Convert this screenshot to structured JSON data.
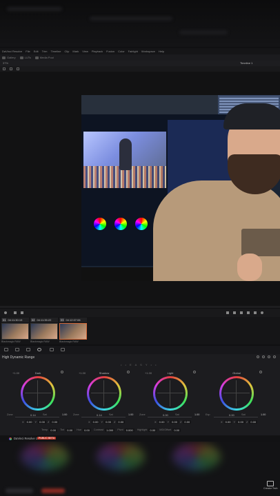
{
  "menu": {
    "items": [
      "DaVinci Resolve",
      "File",
      "Edit",
      "Trim",
      "Timeline",
      "Clip",
      "Mark",
      "View",
      "Playback",
      "Fusion",
      "Color",
      "Fairlight",
      "Workspace",
      "Help"
    ]
  },
  "toolbar": {
    "items": [
      "Gallery",
      "LUTs",
      "Media Pool"
    ]
  },
  "viewer": {
    "zoom": "37%",
    "timeline_name": "Timeline 1"
  },
  "clips": [
    {
      "num": "01",
      "timecode": "04:11:30:19",
      "label": "Blackmagic RAW",
      "selected": false
    },
    {
      "num": "02",
      "timecode": "04:11:35:22",
      "label": "Blackmagic RAW",
      "selected": false
    },
    {
      "num": "03",
      "timecode": "04:12:07:06",
      "label": "Blackmagic RAW",
      "selected": true
    }
  ],
  "hdr_panel": {
    "title": "High Dynamic Range",
    "mode_label": "• • E A S Y • •",
    "zones": [
      {
        "name": "Dark",
        "exp": "+1.00",
        "tag_left": "Zone",
        "slider_val": "0.14",
        "tag_right": "Sat",
        "sat": "1.00",
        "x": "0.00",
        "y": "0.00",
        "z": "0.00"
      },
      {
        "name": "Shadow",
        "exp": "+1.00",
        "tag_left": "Zone",
        "slider_val": "0.14",
        "tag_right": "Sat",
        "sat": "1.00",
        "x": "0.00",
        "y": "0.00",
        "z": "0.00"
      },
      {
        "name": "Light",
        "exp": "+1.00",
        "tag_left": "Zone",
        "slider_val": "0.00",
        "tag_right": "Sat",
        "sat": "1.00",
        "x": "0.00",
        "y": "0.00",
        "z": "0.00"
      },
      {
        "name": "Global",
        "exp": "",
        "tag_left": "Exp",
        "slider_val": "0.00",
        "tag_right": "Sat",
        "sat": "1.00",
        "x": "0.00",
        "y": "0.00",
        "z": "0.00"
      }
    ],
    "params": [
      {
        "k": "Temp",
        "v": "0.00"
      },
      {
        "k": "Tint",
        "v": "0.00"
      },
      {
        "k": "Hue",
        "v": "0.00"
      },
      {
        "k": "Contrast",
        "v": "1.000"
      },
      {
        "k": "Pivot",
        "v": "0.000"
      },
      {
        "k": "Highlight",
        "v": "0.00"
      },
      {
        "k": "MD/Offset",
        "v": "0.00"
      }
    ]
  },
  "footer": {
    "app": "DaVinci Resolve 17",
    "badge": "PUBLIC BETA"
  },
  "watermark": {
    "text": "Creator Tech"
  },
  "colors": {
    "accent_selected": "#d46a3a",
    "badge": "#c0392b"
  }
}
